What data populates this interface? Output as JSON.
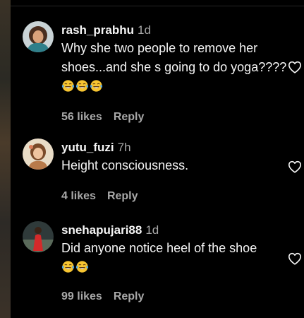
{
  "comments": [
    {
      "username": "rash_prabhu",
      "time": "1d",
      "text": "Why she two people to remove her shoes...and she s going to do yoga????",
      "emojis": [
        "face-with-tears-of-joy",
        "face-with-tears-of-joy",
        "face-with-tears-of-joy"
      ],
      "likes": "56 likes",
      "reply": "Reply"
    },
    {
      "username": "yutu_fuzi",
      "time": "7h",
      "text": "Height consciousness.",
      "emojis": [],
      "likes": "4 likes",
      "reply": "Reply"
    },
    {
      "username": "snehapujari88",
      "time": "1d",
      "text": "Did anyone notice heel of the shoe",
      "emojis": [
        "face-with-tears-of-joy",
        "face-with-tears-of-joy"
      ],
      "likes": "99 likes",
      "reply": "Reply"
    }
  ],
  "icons": {
    "like": "heart-outline-icon",
    "emoji": "face-with-tears-of-joy"
  },
  "colors": {
    "background": "#000000",
    "primary_text": "#f5f5f5",
    "secondary_text": "#a8a8a8",
    "emoji_face": "#f7c531",
    "emoji_tears": "#4fa3e0"
  }
}
